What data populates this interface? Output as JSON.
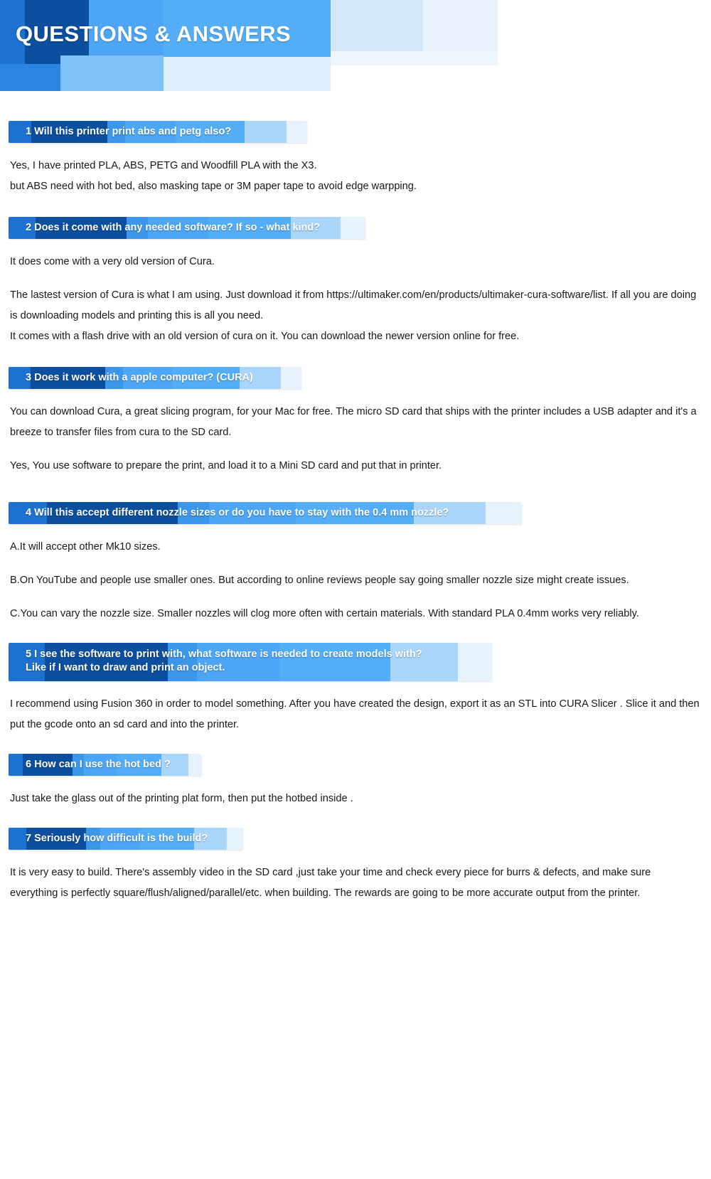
{
  "header": {
    "title": "QUESTIONS & ANSWERS",
    "colors": {
      "dark_blue": "#0b4f9e",
      "blue": "#1d72cf",
      "mid_blue": "#4ca6f5",
      "light_blue": "#7cc2f8",
      "pale_blue": "#d4e8fb",
      "faint_blue": "#eef6fd"
    }
  },
  "qa": [
    {
      "number": "1",
      "question": "1 Will this printer print abs and petg also?",
      "banner_width": 420,
      "lines": 1,
      "answer_blocks": [
        "Yes, I have printed PLA, ABS, PETG and Woodfill PLA with the X3.\nbut ABS need with hot bed, also masking tape or 3M paper tape to avoid edge warpping."
      ]
    },
    {
      "number": "2",
      "question": "2 Does it come with any needed software? If so - what kind?",
      "banner_width": 502,
      "lines": 1,
      "answer_blocks": [
        "It does come with a very old version of Cura.",
        "The lastest version of Cura is what I am using. Just download it from https://ultimaker.com/en/products/ultimaker-cura-software/list. If all you are doing is downloading models and printing this is all you need.\nIt comes with a flash drive with an old version of cura on it. You can download the newer version online for free."
      ]
    },
    {
      "number": "3",
      "question": "3 Does it work with a apple computer?   (CURA)",
      "banner_width": 412,
      "lines": 1,
      "answer_blocks": [
        "You can download Cura, a great slicing program, for your Mac for free. The micro SD card that ships with the printer includes a USB adapter and it's a breeze to transfer files from cura to the SD card.",
        "Yes, You use software to prepare the print, and load it to a Mini SD card and put that in printer."
      ]
    },
    {
      "number": "4",
      "question": "4 Will this accept different nozzle sizes or do you have to stay with the 0.4 mm nozzle?",
      "banner_width": 722,
      "lines": 1,
      "answer_blocks": [
        "A.It will accept other Mk10 sizes.",
        "B.On YouTube and people use smaller ones. But according to online reviews people say going smaller nozzle size might create issues.",
        "C.You can vary the nozzle size. Smaller nozzles will clog more often with certain materials. With standard PLA 0.4mm works very reliably."
      ]
    },
    {
      "number": "5",
      "question": "5 I see the software to print with, what software is needed to create models with?\nLike if I want to draw and print an object.",
      "banner_width": 680,
      "lines": 2,
      "answer_blocks": [
        "I recommend using Fusion 360 in order to model something. After you have created the design, export it as an STL into CURA Slicer . Slice it and then put the gcode onto an sd card and into the printer."
      ]
    },
    {
      "number": "6",
      "question": "6 How can I use the hot bed ?",
      "banner_width": 272,
      "lines": 1,
      "answer_blocks": [
        "Just take the glass out of the printing plat form, then put the hotbed inside ."
      ]
    },
    {
      "number": "7",
      "question": "7 Seriously how difficult is the build?",
      "banner_width": 330,
      "lines": 1,
      "answer_blocks": [
        "It is very easy to build. There's assembly video in the SD card ,just take your time and check every piece for burrs & defects, and make sure everything is perfectly square/flush/aligned/parallel/etc. when building. The rewards are going to be more accurate output from the printer."
      ]
    }
  ]
}
